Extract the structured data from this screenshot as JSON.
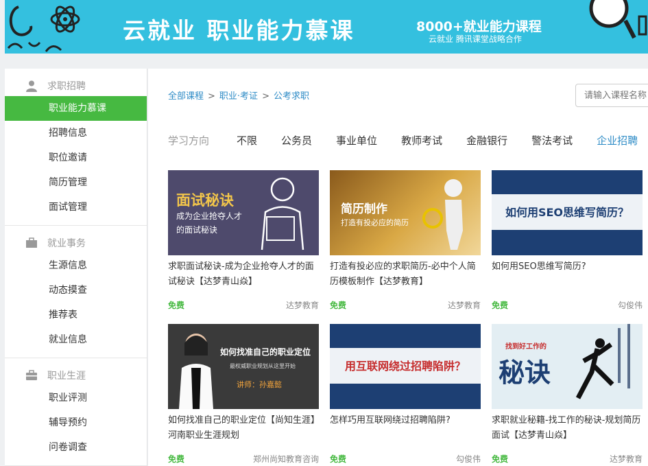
{
  "banner": {
    "title": "云就业  职业能力慕课",
    "slogan": "8000+就业能力课程",
    "sub": "云就业  腾讯课堂战略合作"
  },
  "sidebar": {
    "groups": [
      {
        "label": "求职招聘",
        "icon": "user-icon",
        "items": [
          "职业能力慕课",
          "招聘信息",
          "职位邀请",
          "简历管理",
          "面试管理"
        ]
      },
      {
        "label": "就业事务",
        "icon": "briefcase-icon",
        "items": [
          "生源信息",
          "动态摸查",
          "推荐表",
          "就业信息"
        ]
      },
      {
        "label": "职业生涯",
        "icon": "suitcase-icon",
        "items": [
          "职业评测",
          "辅导预约",
          "问卷调查"
        ]
      }
    ],
    "active_item": "职业能力慕课"
  },
  "breadcrumb": {
    "items": [
      "全部课程",
      "职业·考证",
      "公考求职"
    ],
    "sep": ">"
  },
  "search": {
    "placeholder": "请输入课程名称"
  },
  "filters": {
    "label": "学习方向",
    "options": [
      "不限",
      "公务员",
      "事业单位",
      "教师考试",
      "金融银行",
      "警法考试",
      "企业招聘"
    ],
    "active": "企业招聘"
  },
  "courses": [
    {
      "title": "求职面试秘诀-成为企业抢夺人才的面试秘诀【达梦青山焱】",
      "price": "免费",
      "org": "达梦教育",
      "thumb": {
        "bg": "#4e4a6c",
        "h1": "面试秘诀",
        "h2": "成为企业抢夺人才",
        "h3": "的面试秘诀"
      }
    },
    {
      "title": "打造有投必应的求职简历-必中个人简历模板制作【达梦教育】",
      "price": "免费",
      "org": "达梦教育",
      "thumb": {
        "bg": "#c59a3c",
        "h1": "简历制作",
        "h2": "打造有投必应的简历"
      }
    },
    {
      "title": "如何用SEO思维写简历?",
      "price": "免费",
      "org": "勾俊伟",
      "thumb": {
        "bg": "#1d3f73",
        "h1": "如何用SEO思维写简历？"
      }
    },
    {
      "title": "如何找准自己的职业定位【尚知生涯】河南职业生涯规划",
      "price": "免费",
      "org": "郑州尚知教育咨询",
      "thumb": {
        "bg": "#3a3a3a",
        "h1": "如何找准自己的职业定位",
        "h2": "最权威职业规划从这里开始",
        "h3": "讲师：孙嘉懿"
      }
    },
    {
      "title": "怎样巧用互联网绕过招聘陷阱?",
      "price": "免费",
      "org": "勾俊伟",
      "thumb": {
        "bg": "#1d3f73",
        "h1": "用互联网绕过招聘陷阱？"
      }
    },
    {
      "title": "求职就业秘籍-找工作的秘诀-规划简历面试【达梦青山焱】",
      "price": "免费",
      "org": "达梦教育",
      "thumb": {
        "bg": "#e3eef3",
        "h1": "秘诀",
        "h2": "找到好工作的"
      }
    }
  ]
}
